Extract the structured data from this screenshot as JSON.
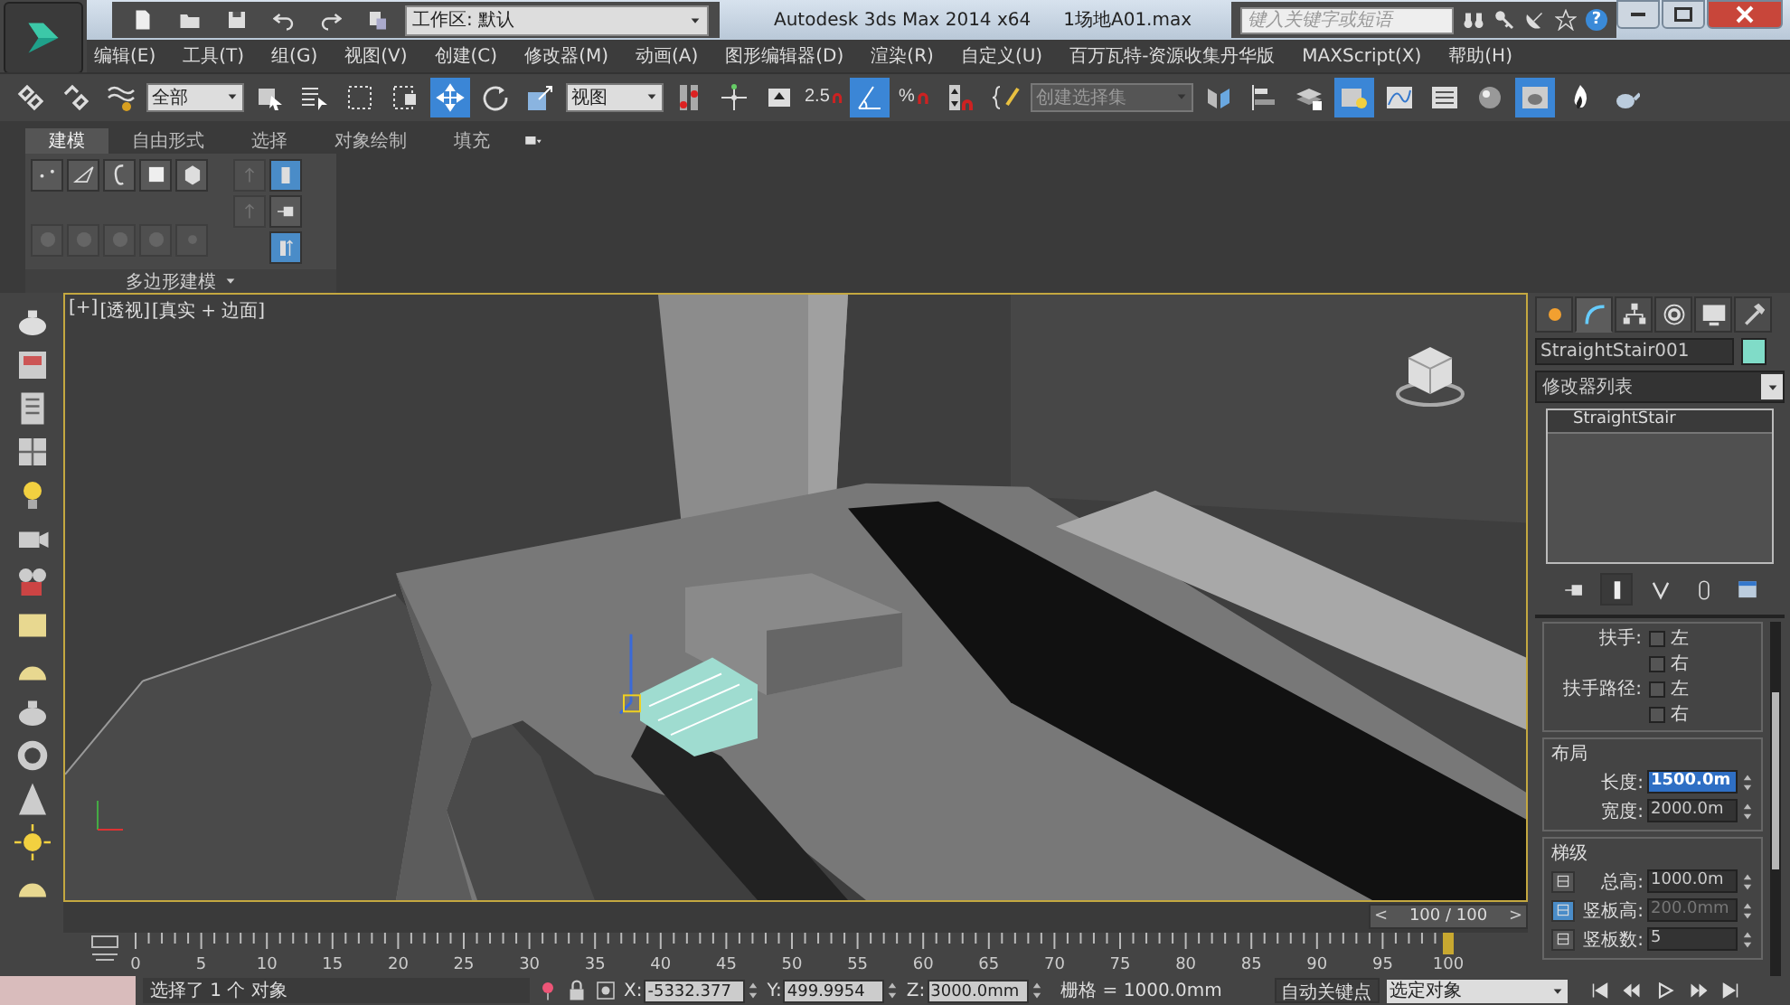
{
  "title_bar": {
    "workspace": "工作区: 默认",
    "app_title": "Autodesk 3ds Max  2014 x64",
    "file_name": "1场地A01.max",
    "search": {
      "placeholder": "键入关键字或短语"
    },
    "help": "?"
  },
  "menu": [
    "编辑(E)",
    "工具(T)",
    "组(G)",
    "视图(V)",
    "创建(C)",
    "修改器(M)",
    "动画(A)",
    "图形编辑器(D)",
    "渲染(R)",
    "自定义(U)",
    "百万瓦特-资源收集丹华版",
    "MAXScript(X)",
    "帮助(H)"
  ],
  "toolbar": [
    {
      "kind": "button",
      "selected": false
    },
    {
      "kind": "button",
      "selected": false
    },
    {
      "kind": "button",
      "selected": false
    },
    {
      "kind": "dropdown",
      "value": "全部"
    },
    {
      "kind": "button",
      "selected": false
    },
    {
      "kind": "button",
      "selected": false
    },
    {
      "kind": "button",
      "selected": false
    },
    {
      "kind": "button",
      "selected": false
    },
    {
      "kind": "button",
      "selected": true
    },
    {
      "kind": "button",
      "selected": false
    },
    {
      "kind": "button",
      "selected": false
    },
    {
      "kind": "dropdown",
      "value": "视图"
    },
    {
      "kind": "button",
      "selected": false
    },
    {
      "kind": "button",
      "selected": false
    },
    {
      "kind": "button",
      "selected": false
    },
    {
      "kind": "button",
      "text": "2.5",
      "selected": false
    },
    {
      "kind": "button",
      "selected": true
    },
    {
      "kind": "button",
      "text": "%",
      "selected": false
    },
    {
      "kind": "button",
      "selected": false
    },
    {
      "kind": "button",
      "selected": false
    },
    {
      "kind": "dropdown",
      "placeholder": "创建选择集"
    },
    {
      "kind": "button",
      "selected": false
    },
    {
      "kind": "button",
      "selected": false
    },
    {
      "kind": "button",
      "selected": false
    },
    {
      "kind": "button",
      "selected": true
    },
    {
      "kind": "button",
      "selected": false
    },
    {
      "kind": "button",
      "selected": false
    },
    {
      "kind": "button",
      "selected": false
    },
    {
      "kind": "button",
      "selected": true
    },
    {
      "kind": "button",
      "selected": false
    },
    {
      "kind": "button",
      "selected": false
    }
  ],
  "ribbon": {
    "tabs": [
      {
        "label": "建模",
        "selected": true
      },
      {
        "label": "自由形式",
        "selected": false
      },
      {
        "label": "选择",
        "selected": false
      },
      {
        "label": "对象绘制",
        "selected": false
      },
      {
        "label": "填充",
        "selected": false
      }
    ],
    "panel": {
      "title": "多边形建模",
      "buttons": [
        {
          "disabled": false
        },
        {
          "disabled": false
        },
        {
          "disabled": false
        },
        {
          "disabled": false
        },
        {
          "disabled": false
        },
        {
          "disabled": true
        },
        {
          "disabled": true
        },
        {
          "disabled": true
        },
        {
          "disabled": true
        },
        {
          "disabled": true
        }
      ],
      "side_buttons": [
        {
          "selected": true
        },
        {
          "selected": false
        },
        {
          "selected": true
        }
      ]
    }
  },
  "viewport": {
    "labels": [
      "[+]",
      "[透视]",
      "[真实 + 边面]"
    ]
  },
  "command_panel": {
    "tabs": [
      {
        "selected": false
      },
      {
        "selected": true
      },
      {
        "selected": false
      },
      {
        "selected": false
      },
      {
        "selected": false
      },
      {
        "selected": false
      }
    ],
    "object": {
      "name": "StraightStair001",
      "color": "#80dcc8"
    },
    "modifier_list": "修改器列表",
    "stack": [
      {
        "label": "StraightStair",
        "selected": true
      }
    ],
    "stack_buttons": [
      {
        "selected": false
      },
      {
        "selected": true
      },
      {
        "selected": false
      },
      {
        "selected": false
      },
      {
        "selected": false
      }
    ],
    "railing": [
      {
        "label": "扶手:",
        "options": [
          {
            "label": "左",
            "checked": false
          },
          {
            "label": "右",
            "checked": false
          }
        ]
      },
      {
        "label": "扶手路径:",
        "options": [
          {
            "label": "左",
            "checked": false
          },
          {
            "label": "右",
            "checked": false
          }
        ]
      }
    ],
    "layout": {
      "title": "布局",
      "fields": [
        {
          "label": "长度:",
          "value": "1500.0m",
          "selected": true
        },
        {
          "label": "宽度:",
          "value": "2000.0m",
          "selected": false
        }
      ]
    },
    "steps": {
      "title": "梯级",
      "fields": [
        {
          "label": "总高:",
          "value": "1000.0m",
          "locked": false,
          "disabled": false
        },
        {
          "label": "竖板高:",
          "value": "200.0mm",
          "locked": true,
          "disabled": true
        },
        {
          "label": "竖板数:",
          "value": "5",
          "locked": false,
          "disabled": false
        }
      ]
    }
  },
  "time_slider": {
    "label": "100 / 100",
    "level": 1,
    "prev": "<",
    "next": ">"
  },
  "ruler_ticks": [
    "0",
    "5",
    "10",
    "15",
    "20",
    "25",
    "30",
    "35",
    "40",
    "45",
    "50",
    "55",
    "60",
    "65",
    "70",
    "75",
    "80",
    "85",
    "90",
    "95",
    "100"
  ],
  "status": {
    "selection_text": "选择了 1 个 对象",
    "coords": [
      {
        "label": "X:",
        "value": "-5332.377"
      },
      {
        "label": "Y:",
        "value": "499.9954"
      },
      {
        "label": "Z:",
        "value": "3000.0mm"
      }
    ],
    "grid": "栅格 = 1000.0mm",
    "auto_key": "自动关键点",
    "key_filter": "选定对象"
  }
}
